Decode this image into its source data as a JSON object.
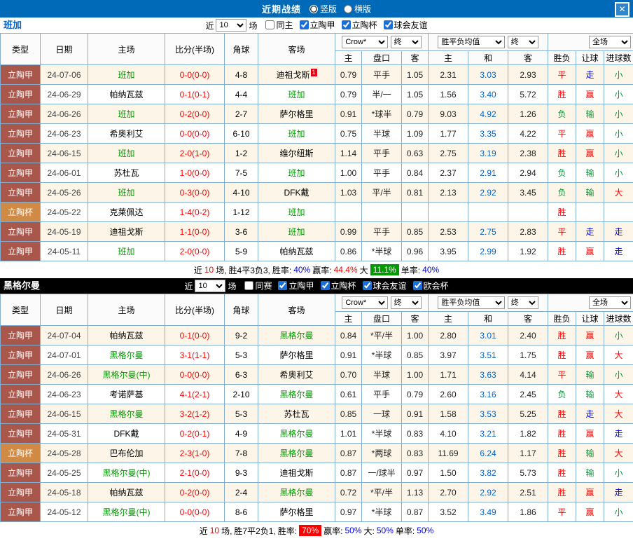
{
  "titlebar": {
    "title": "近期战绩",
    "radio_vertical": "竖版",
    "radio_horizontal": "横版",
    "vertical_checked": true,
    "horizontal_checked": false,
    "close_glyph": "✕"
  },
  "colors": {
    "titlebar_bg": "#0069b8",
    "focus_team_green": "#009900",
    "score_red": "#ff0000",
    "league_cell_bg": "#a9574b",
    "cup_cell_bg": "#cf8a45",
    "win_red": "#ff0000",
    "lose_green": "#009933",
    "push_blue": "#0000e0",
    "draw_odds_blue": "#0066cc",
    "over_badge_bg": "#009900",
    "win_badge_bg": "#ff0000",
    "checkbox_accent": "#1b6fd6",
    "row_stripe": "#fdf6e8",
    "grid_border": "#84aed1"
  },
  "sections": [
    {
      "team": "班加",
      "filter": {
        "near": "近",
        "count": "10",
        "games": "场",
        "checks": [
          {
            "label": "同主",
            "checked": false
          },
          {
            "label": "立陶甲",
            "checked": true
          },
          {
            "label": "立陶杯",
            "checked": true
          },
          {
            "label": "球会友谊",
            "checked": true
          }
        ]
      },
      "header": {
        "cols": [
          "类型",
          "日期",
          "主场",
          "比分(半场)",
          "角球",
          "客场"
        ],
        "book": "Crow*",
        "end": "终",
        "avg": "胜平负均值",
        "end2": "终",
        "scope": "全场",
        "sub": [
          "主",
          "盘口",
          "客",
          "主",
          "和",
          "客",
          "胜负",
          "让球",
          "进球数"
        ]
      },
      "rows": [
        {
          "league": "立陶甲",
          "date": "24-07-06",
          "home": "班加",
          "hf": true,
          "score": "0-0(0-0)",
          "corner": "4-8",
          "away": "迪祖戈斯",
          "badge": "1",
          "oh": "0.79",
          "line": "平手",
          "oa": "1.05",
          "ah": "2.31",
          "ad": "3.03",
          "aa": "2.93",
          "res": "平",
          "rc": "r",
          "hres": "走",
          "hc": "b",
          "gres": "小",
          "gc": "g"
        },
        {
          "league": "立陶甲",
          "date": "24-06-29",
          "home": "帕纳瓦兹",
          "score": "0-1(0-1)",
          "corner": "4-4",
          "away": "班加",
          "af": true,
          "oh": "0.79",
          "line": "半/一",
          "oa": "1.05",
          "ah": "1.56",
          "ad": "3.40",
          "aa": "5.72",
          "res": "胜",
          "rc": "r",
          "hres": "赢",
          "hc": "r",
          "gres": "小",
          "gc": "g"
        },
        {
          "league": "立陶甲",
          "date": "24-06-26",
          "home": "班加",
          "hf": true,
          "score": "0-2(0-0)",
          "corner": "2-7",
          "away": "萨尔格里",
          "oh": "0.91",
          "line": "*球半",
          "oa": "0.79",
          "ah": "9.03",
          "ad": "4.92",
          "aa": "1.26",
          "res": "负",
          "rc": "g",
          "hres": "输",
          "hc": "g",
          "gres": "小",
          "gc": "g"
        },
        {
          "league": "立陶甲",
          "date": "24-06-23",
          "home": "希奥利艾",
          "score": "0-0(0-0)",
          "corner": "6-10",
          "away": "班加",
          "af": true,
          "oh": "0.75",
          "line": "半球",
          "oa": "1.09",
          "ah": "1.77",
          "ad": "3.35",
          "aa": "4.22",
          "res": "平",
          "rc": "r",
          "hres": "赢",
          "hc": "r",
          "gres": "小",
          "gc": "g"
        },
        {
          "league": "立陶甲",
          "date": "24-06-15",
          "home": "班加",
          "hf": true,
          "score": "2-0(1-0)",
          "corner": "1-2",
          "away": "维尔纽斯",
          "oh": "1.14",
          "line": "平手",
          "oa": "0.63",
          "ah": "2.75",
          "ad": "3.19",
          "aa": "2.38",
          "res": "胜",
          "rc": "r",
          "hres": "赢",
          "hc": "r",
          "gres": "小",
          "gc": "g"
        },
        {
          "league": "立陶甲",
          "date": "24-06-01",
          "home": "苏杜瓦",
          "score": "1-0(0-0)",
          "corner": "7-5",
          "away": "班加",
          "af": true,
          "oh": "1.00",
          "line": "平手",
          "oa": "0.84",
          "ah": "2.37",
          "ad": "2.91",
          "aa": "2.94",
          "res": "负",
          "rc": "g",
          "hres": "输",
          "hc": "g",
          "gres": "小",
          "gc": "g"
        },
        {
          "league": "立陶甲",
          "date": "24-05-26",
          "home": "班加",
          "hf": true,
          "score": "0-3(0-0)",
          "corner": "4-10",
          "away": "DFK戴",
          "oh": "1.03",
          "line": "平/半",
          "oa": "0.81",
          "ah": "2.13",
          "ad": "2.92",
          "aa": "3.45",
          "res": "负",
          "rc": "g",
          "hres": "输",
          "hc": "g",
          "gres": "大",
          "gc": "r"
        },
        {
          "league": "立陶杯",
          "cup": true,
          "date": "24-05-22",
          "home": "克莱佩达",
          "score": "1-4(0-2)",
          "corner": "1-12",
          "away": "班加",
          "af": true,
          "oh": "",
          "line": "",
          "oa": "",
          "ah": "",
          "ad": "",
          "aa": "",
          "res": "胜",
          "rc": "r",
          "hres": "",
          "gres": ""
        },
        {
          "league": "立陶甲",
          "date": "24-05-19",
          "home": "迪祖戈斯",
          "score": "1-1(0-0)",
          "corner": "3-6",
          "away": "班加",
          "af": true,
          "oh": "0.99",
          "line": "平手",
          "oa": "0.85",
          "ah": "2.53",
          "ad": "2.75",
          "aa": "2.83",
          "res": "平",
          "rc": "r",
          "hres": "走",
          "hc": "b",
          "gres": "走",
          "gc": "b"
        },
        {
          "league": "立陶甲",
          "date": "24-05-11",
          "home": "班加",
          "hf": true,
          "score": "2-0(0-0)",
          "corner": "5-9",
          "away": "帕纳瓦兹",
          "oh": "0.86",
          "line": "*半球",
          "oa": "0.96",
          "ah": "3.95",
          "ad": "2.99",
          "aa": "1.92",
          "res": "胜",
          "rc": "r",
          "hres": "赢",
          "hc": "r",
          "gres": "走",
          "gc": "b"
        }
      ],
      "summary": {
        "near": "近",
        "count": "10",
        "games": "场,",
        "record": "胜4平3负3,",
        "win_label": "胜率:",
        "win_value": "40%",
        "cover_label": "赢率:",
        "cover_value": "44.4%",
        "over_label": "大",
        "over_value": "11.1%",
        "single_label": "单率:",
        "single_value": "40%"
      }
    },
    {
      "team": "黑格尔曼",
      "filter": {
        "near": "近",
        "count": "10",
        "games": "场",
        "checks": [
          {
            "label": "同赛",
            "checked": false
          },
          {
            "label": "立陶甲",
            "checked": true
          },
          {
            "label": "立陶杯",
            "checked": true
          },
          {
            "label": "球会友谊",
            "checked": true
          },
          {
            "label": "欧会杯",
            "checked": true
          }
        ]
      },
      "header": {
        "cols": [
          "类型",
          "日期",
          "主场",
          "比分(半场)",
          "角球",
          "客场"
        ],
        "book": "Crow*",
        "end": "终",
        "avg": "胜平负均值",
        "end2": "终",
        "scope": "全场",
        "sub": [
          "主",
          "盘口",
          "客",
          "主",
          "和",
          "客",
          "胜负",
          "让球",
          "进球数"
        ]
      },
      "rows": [
        {
          "league": "立陶甲",
          "date": "24-07-04",
          "home": "帕纳瓦兹",
          "score": "0-1(0-0)",
          "corner": "9-2",
          "away": "黑格尔曼",
          "af": true,
          "oh": "0.84",
          "line": "*平/半",
          "oa": "1.00",
          "ah": "2.80",
          "ad": "3.01",
          "aa": "2.40",
          "res": "胜",
          "rc": "r",
          "hres": "赢",
          "hc": "r",
          "gres": "小",
          "gc": "g"
        },
        {
          "league": "立陶甲",
          "date": "24-07-01",
          "home": "黑格尔曼",
          "hf": true,
          "score": "3-1(1-1)",
          "corner": "5-3",
          "away": "萨尔格里",
          "oh": "0.91",
          "line": "*半球",
          "oa": "0.85",
          "ah": "3.97",
          "ad": "3.51",
          "aa": "1.75",
          "res": "胜",
          "rc": "r",
          "hres": "赢",
          "hc": "r",
          "gres": "大",
          "gc": "r"
        },
        {
          "league": "立陶甲",
          "date": "24-06-26",
          "home": "黑格尔曼(中)",
          "hf": true,
          "score": "0-0(0-0)",
          "corner": "6-3",
          "away": "希奥利艾",
          "oh": "0.70",
          "line": "半球",
          "oa": "1.00",
          "ah": "1.71",
          "ad": "3.63",
          "aa": "4.14",
          "res": "平",
          "rc": "r",
          "hres": "输",
          "hc": "g",
          "gres": "小",
          "gc": "g"
        },
        {
          "league": "立陶甲",
          "date": "24-06-23",
          "home": "考诺萨基",
          "score": "4-1(2-1)",
          "corner": "2-10",
          "away": "黑格尔曼",
          "af": true,
          "oh": "0.61",
          "line": "平手",
          "oa": "0.79",
          "ah": "2.60",
          "ad": "3.16",
          "aa": "2.45",
          "res": "负",
          "rc": "g",
          "hres": "输",
          "hc": "g",
          "gres": "大",
          "gc": "r"
        },
        {
          "league": "立陶甲",
          "date": "24-06-15",
          "home": "黑格尔曼",
          "hf": true,
          "score": "3-2(1-2)",
          "corner": "5-3",
          "away": "苏杜瓦",
          "oh": "0.85",
          "line": "一球",
          "oa": "0.91",
          "ah": "1.58",
          "ad": "3.53",
          "aa": "5.25",
          "res": "胜",
          "rc": "r",
          "hres": "走",
          "hc": "b",
          "gres": "大",
          "gc": "r"
        },
        {
          "league": "立陶甲",
          "date": "24-05-31",
          "home": "DFK戴",
          "score": "0-2(0-1)",
          "corner": "4-9",
          "away": "黑格尔曼",
          "af": true,
          "oh": "1.01",
          "line": "*半球",
          "oa": "0.83",
          "ah": "4.10",
          "ad": "3.21",
          "aa": "1.82",
          "res": "胜",
          "rc": "r",
          "hres": "赢",
          "hc": "r",
          "gres": "走",
          "gc": "b"
        },
        {
          "league": "立陶杯",
          "cup": true,
          "date": "24-05-28",
          "home": "巴布伦加",
          "score": "2-3(1-0)",
          "corner": "7-8",
          "away": "黑格尔曼",
          "af": true,
          "oh": "0.87",
          "line": "*两球",
          "oa": "0.83",
          "ah": "11.69",
          "ad": "6.24",
          "aa": "1.17",
          "res": "胜",
          "rc": "r",
          "hres": "输",
          "hc": "g",
          "gres": "大",
          "gc": "r"
        },
        {
          "league": "立陶甲",
          "date": "24-05-25",
          "home": "黑格尔曼(中)",
          "hf": true,
          "score": "2-1(0-0)",
          "corner": "9-3",
          "away": "迪祖戈斯",
          "oh": "0.87",
          "line": "一/球半",
          "oa": "0.97",
          "ah": "1.50",
          "ad": "3.82",
          "aa": "5.73",
          "res": "胜",
          "rc": "r",
          "hres": "输",
          "hc": "g",
          "gres": "小",
          "gc": "g"
        },
        {
          "league": "立陶甲",
          "date": "24-05-18",
          "home": "帕纳瓦兹",
          "score": "0-2(0-0)",
          "corner": "2-4",
          "away": "黑格尔曼",
          "af": true,
          "oh": "0.72",
          "line": "*平/半",
          "oa": "1.13",
          "ah": "2.70",
          "ad": "2.92",
          "aa": "2.51",
          "res": "胜",
          "rc": "r",
          "hres": "赢",
          "hc": "r",
          "gres": "走",
          "gc": "b"
        },
        {
          "league": "立陶甲",
          "date": "24-05-12",
          "home": "黑格尔曼(中)",
          "hf": true,
          "score": "0-0(0-0)",
          "corner": "8-6",
          "away": "萨尔格里",
          "oh": "0.97",
          "line": "*半球",
          "oa": "0.87",
          "ah": "3.52",
          "ad": "3.49",
          "aa": "1.86",
          "res": "平",
          "rc": "r",
          "hres": "赢",
          "hc": "r",
          "gres": "小",
          "gc": "g"
        }
      ],
      "summary": {
        "near": "近",
        "count": "10",
        "games": "场,",
        "record": "胜7平2负1,",
        "win_label": "胜率:",
        "win_value": "70%",
        "cover_label": "赢率:",
        "cover_value": "50%",
        "over_label": "大:",
        "over_value": "50%",
        "single_label": "单率:",
        "single_value": "50%"
      }
    }
  ]
}
